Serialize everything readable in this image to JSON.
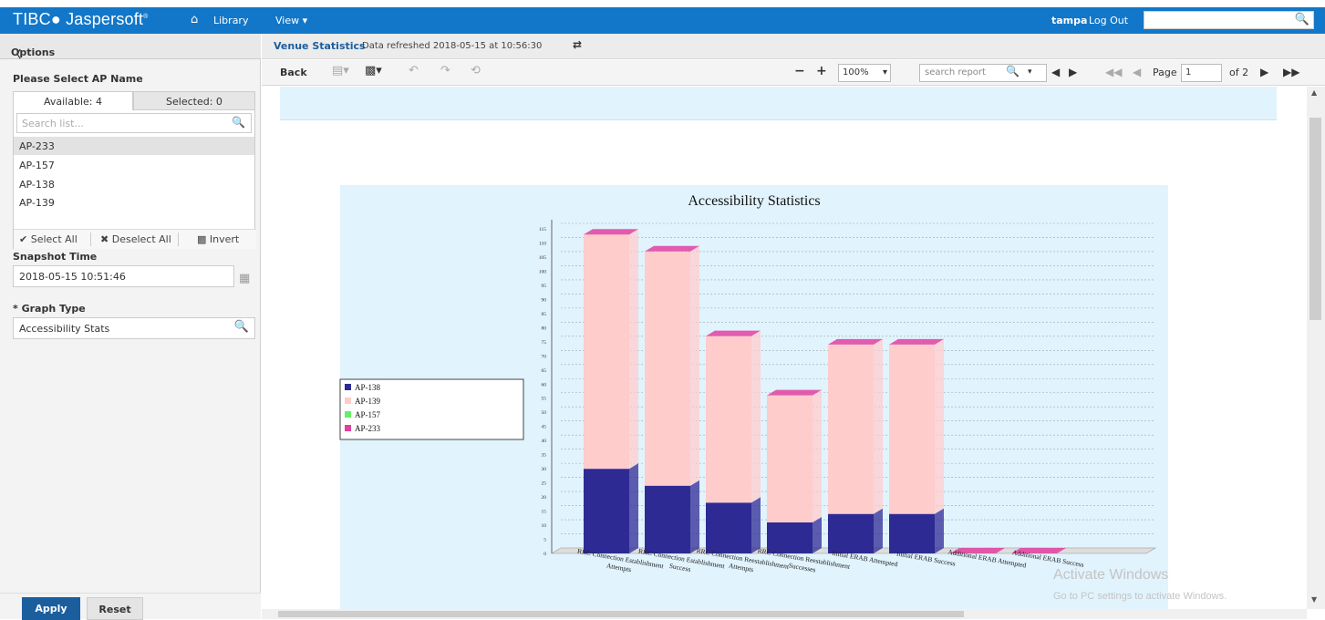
{
  "app": {
    "brand": "TIBCO Jaspersoft"
  },
  "nav": {
    "library": "Library",
    "view": "View ▾",
    "user": "tampa",
    "logout": "Log Out"
  },
  "options": {
    "title": "Options",
    "ap_label": "Please Select AP Name",
    "tab_available": "Available: 4",
    "tab_selected": "Selected: 0",
    "search_placeholder": "Search list...",
    "items": [
      "AP-233",
      "AP-157",
      "AP-138",
      "AP-139"
    ],
    "select_all": "Select All",
    "deselect_all": "Deselect All",
    "invert": "Invert",
    "snapshot_label": "Snapshot Time",
    "snapshot_value": "2018-05-15 10:51:46",
    "graph_label": "* Graph Type",
    "graph_value": "Accessibility Stats",
    "apply": "Apply",
    "reset": "Reset"
  },
  "report": {
    "title": "Venue Statistics",
    "refreshed": "Data refreshed 2018-05-15 at 10:56:30",
    "back": "Back",
    "zoom": "100%",
    "search_placeholder": "search report",
    "page_label": "Page",
    "page_value": "1",
    "page_of": "of 2"
  },
  "watermark": {
    "line1": "Activate Windows",
    "line2": "Go to PC settings to activate Windows."
  },
  "colors": {
    "topbar": "#1277c9",
    "chart_bg": "#e1f3fd",
    "ap138": "#2e2a94",
    "ap139": "#ffcccc",
    "ap157": "#66ee66",
    "ap233": "#e040a0"
  },
  "chart_data": {
    "type": "bar",
    "title": "Accessibility Statistics",
    "stacked": true,
    "categories": [
      "RRC Connection Establishment Attempts",
      "RRC Connection Establishment Success",
      "RRC Connection Reestablishment Attempts",
      "RRC Connection Reestablishment Successes",
      "Initial ERAB Attempted",
      "Initial ERAB Success",
      "Additional ERAB Attempted",
      "Additional ERAB Success"
    ],
    "series": [
      {
        "name": "AP-138",
        "color": "#2e2a94",
        "values": [
          30,
          24,
          18,
          11,
          14,
          14,
          0,
          0
        ]
      },
      {
        "name": "AP-139",
        "color": "#ffcccc",
        "values": [
          83,
          83,
          59,
          45,
          60,
          60,
          0,
          0
        ]
      },
      {
        "name": "AP-157",
        "color": "#66ee66",
        "values": [
          0,
          0,
          0,
          0,
          0,
          0,
          0,
          0
        ]
      },
      {
        "name": "AP-233",
        "color": "#e040a0",
        "values": [
          0,
          0,
          0,
          0,
          0,
          0,
          0,
          0
        ]
      }
    ],
    "y_ticks": [
      "0",
      "5",
      "10",
      "15",
      "20",
      "25",
      "30",
      "35",
      "40",
      "45",
      "50",
      "55",
      "60",
      "65",
      "70",
      "75",
      "80",
      "85",
      "90",
      "95",
      "100",
      "105",
      "110",
      "115"
    ],
    "ylim": [
      0,
      115
    ],
    "legend_position": "left",
    "grid": true
  }
}
